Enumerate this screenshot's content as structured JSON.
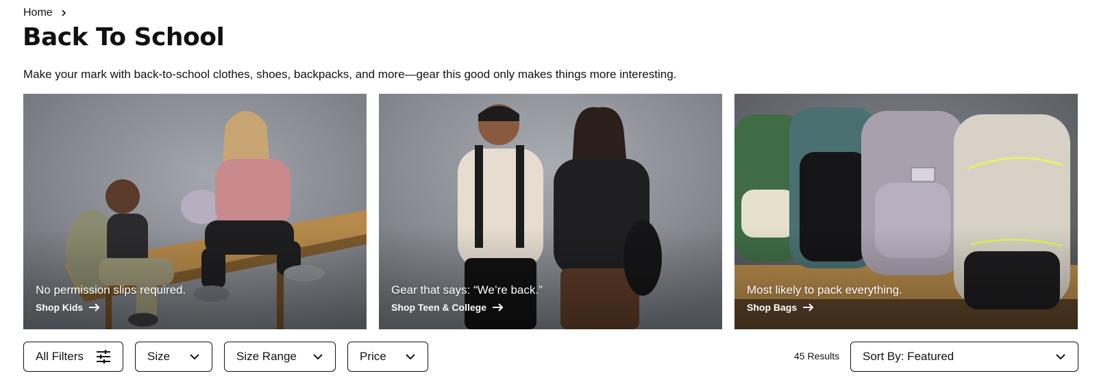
{
  "breadcrumb": {
    "home_label": "Home"
  },
  "page": {
    "title": "Back To School",
    "description": "Make your mark with back-to-school clothes, shoes, backpacks, and more—gear this good only makes things more interesting."
  },
  "tiles": [
    {
      "tagline": "No permission slips required.",
      "cta_label": "Shop Kids",
      "icon": "arrow-right-icon"
    },
    {
      "tagline": "Gear that says: “We’re back.”",
      "cta_label": "Shop Teen & College",
      "icon": "arrow-right-icon"
    },
    {
      "tagline": "Most likely to pack everything.",
      "cta_label": "Shop Bags",
      "icon": "arrow-right-icon"
    }
  ],
  "filters": {
    "all_filters_label": "All Filters",
    "size_label": "Size",
    "size_range_label": "Size Range",
    "price_label": "Price"
  },
  "results": {
    "count_label": "45 Results"
  },
  "sort": {
    "label": "Sort By: Featured",
    "icon": "chevron-down-icon"
  },
  "colors": {
    "text": "#111111",
    "background": "#ffffff",
    "tile_backdrop": "#8c9096",
    "bench_wood": "#b58a4a"
  }
}
